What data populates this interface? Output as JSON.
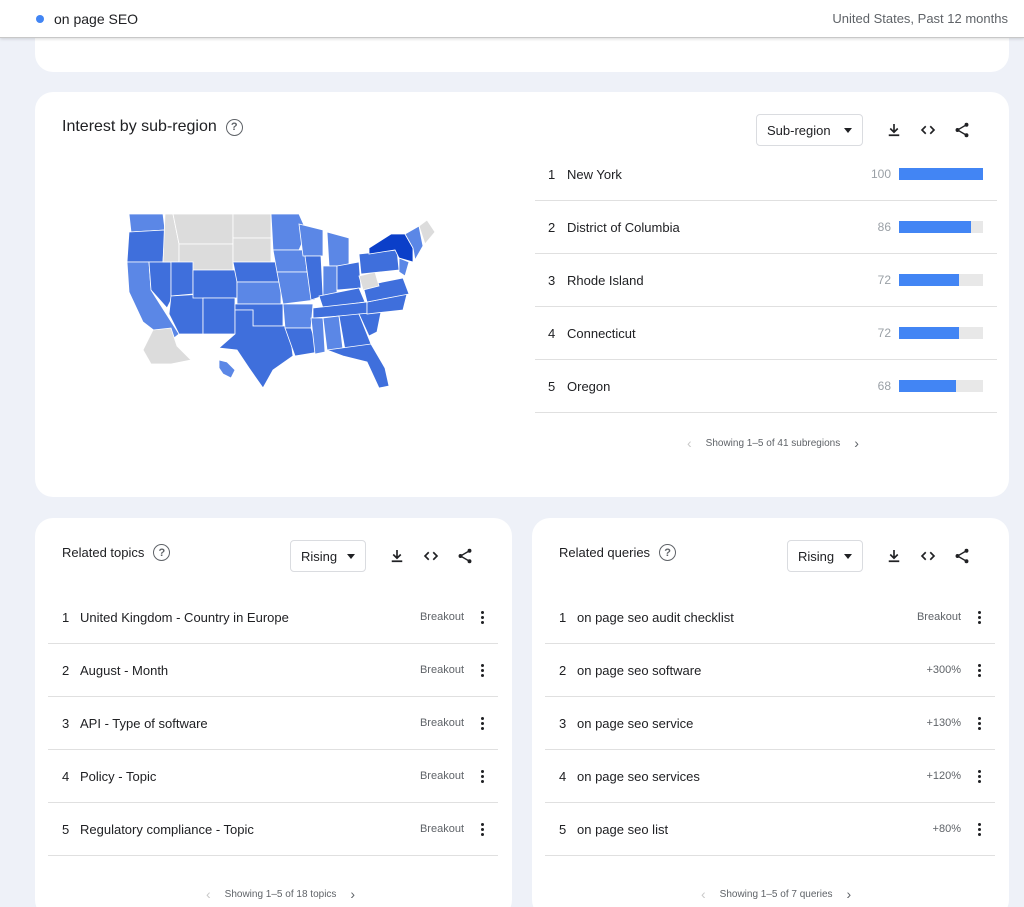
{
  "header": {
    "term": "on page SEO",
    "term_color": "#4285f4",
    "scope": "United States, Past 12 months"
  },
  "region_card": {
    "title": "Interest by sub-region",
    "resolution_select": "Sub-region",
    "icons": [
      "download-icon",
      "embed-icon",
      "share-icon"
    ],
    "map_colors": {
      "highest": "#0b3fc9",
      "high": "#3f6fdc",
      "mid": "#5b87e6",
      "low": "#8fb0ee",
      "no_data": "#dcdcdc"
    },
    "rows": [
      {
        "rank": "1",
        "name": "New York",
        "value": 100
      },
      {
        "rank": "2",
        "name": "District of Columbia",
        "value": 86
      },
      {
        "rank": "3",
        "name": "Rhode Island",
        "value": 72
      },
      {
        "rank": "4",
        "name": "Connecticut",
        "value": 72
      },
      {
        "rank": "5",
        "name": "Oregon",
        "value": 68
      }
    ],
    "pager": "Showing 1–5 of 41 subregions"
  },
  "topics_card": {
    "title": "Related topics",
    "select": "Rising",
    "rows": [
      {
        "rank": "1",
        "name": "United Kingdom - Country in Europe",
        "value": "Breakout"
      },
      {
        "rank": "2",
        "name": "August - Month",
        "value": "Breakout"
      },
      {
        "rank": "3",
        "name": "API - Type of software",
        "value": "Breakout"
      },
      {
        "rank": "4",
        "name": "Policy - Topic",
        "value": "Breakout"
      },
      {
        "rank": "5",
        "name": "Regulatory compliance - Topic",
        "value": "Breakout"
      }
    ],
    "pager": "Showing 1–5 of 18 topics"
  },
  "queries_card": {
    "title": "Related queries",
    "select": "Rising",
    "rows": [
      {
        "rank": "1",
        "name": "on page seo audit checklist",
        "value": "Breakout"
      },
      {
        "rank": "2",
        "name": "on page seo software",
        "value": "+300%"
      },
      {
        "rank": "3",
        "name": "on page seo service",
        "value": "+130%"
      },
      {
        "rank": "4",
        "name": "on page seo services",
        "value": "+120%"
      },
      {
        "rank": "5",
        "name": "on page seo list",
        "value": "+80%"
      }
    ],
    "pager": "Showing 1–5 of 7 queries"
  }
}
